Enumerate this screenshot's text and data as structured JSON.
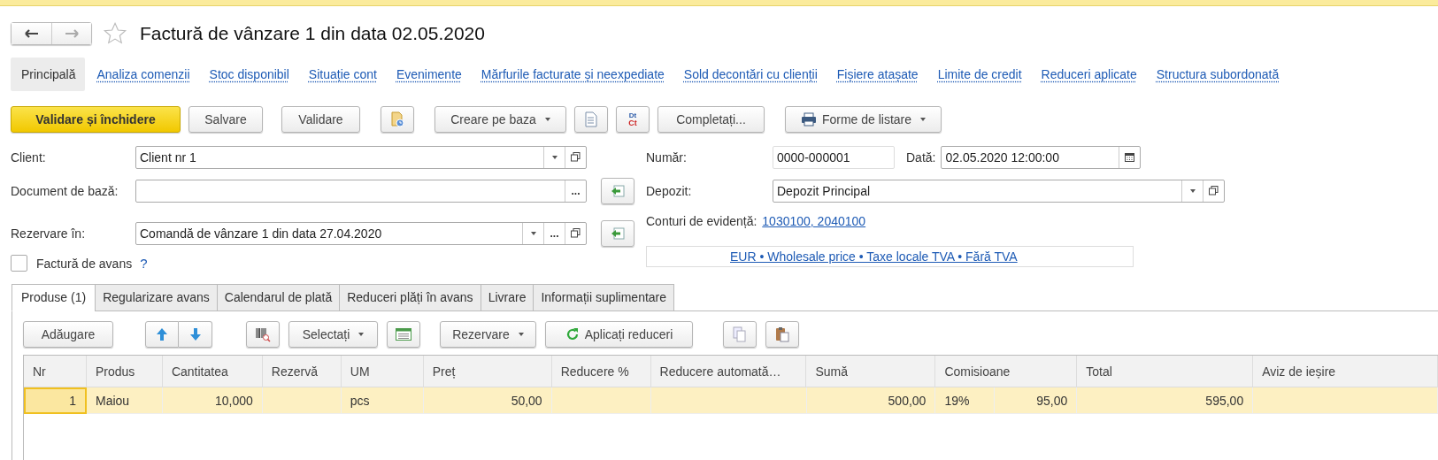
{
  "window": {
    "title": "Factură de vânzare 1 din data 02.05.2020",
    "favorite": false
  },
  "nav": [
    {
      "label": "Principală",
      "selected": true
    },
    {
      "label": "Analiza comenzii",
      "selected": false
    },
    {
      "label": "Stoc disponibil",
      "selected": false
    },
    {
      "label": "Situație cont",
      "selected": false
    },
    {
      "label": "Evenimente",
      "selected": false
    },
    {
      "label": "Mărfurile facturate și neexpediate",
      "selected": false
    },
    {
      "label": "Sold decontări cu clienții",
      "selected": false
    },
    {
      "label": "Fișiere atașate",
      "selected": false
    },
    {
      "label": "Limite de credit",
      "selected": false
    },
    {
      "label": "Reduceri aplicate",
      "selected": false
    },
    {
      "label": "Structura subordonată",
      "selected": false
    }
  ],
  "toolbar": {
    "post_close": "Validare și închidere",
    "save": "Salvare",
    "post": "Validare",
    "create_based": "Creare pe baza",
    "dtct": {
      "top": "Dt",
      "bottom": "Ct"
    },
    "fill": "Completați...",
    "print": "Forme de listare"
  },
  "form": {
    "client": {
      "label": "Client:",
      "value": "Client nr 1"
    },
    "base_document": {
      "label": "Document de bază:",
      "more": "..."
    },
    "reserve_in": {
      "label": "Rezervare în:",
      "value": "Comandă de vânzare 1 din data 27.04.2020",
      "more": "..."
    },
    "advance_invoice": {
      "label": "Factură de avans",
      "checked": false,
      "help": "?"
    },
    "number": {
      "label": "Număr:",
      "value": "0000-000001"
    },
    "date": {
      "label": "Dată:",
      "value": "02.05.2020 12:00:00"
    },
    "warehouse": {
      "label": "Depozit:",
      "value": "Depozit Principal"
    },
    "accounts": {
      "label": "Conturi de evidență:",
      "value": "1030100, 2040100"
    },
    "price_info": "EUR • Wholesale price • Taxe locale TVA • Fără TVA"
  },
  "tabs": [
    {
      "label": "Produse (1)",
      "selected": true
    },
    {
      "label": "Regularizare avans",
      "selected": false
    },
    {
      "label": "Calendarul de plată",
      "selected": false
    },
    {
      "label": "Reduceri plăți în avans",
      "selected": false
    },
    {
      "label": "Livrare",
      "selected": false
    },
    {
      "label": "Informații suplimentare",
      "selected": false
    }
  ],
  "table_toolbar": {
    "add": "Adăugare",
    "select": "Selectați",
    "reserve": "Rezervare",
    "apply_discounts": "Aplicați reduceri"
  },
  "table": {
    "columns": [
      {
        "label": "Nr"
      },
      {
        "label": "Produs"
      },
      {
        "label": "Cantitatea"
      },
      {
        "label": "Rezervă"
      },
      {
        "label": "UM"
      },
      {
        "label": "Preț"
      },
      {
        "label": "Reducere %"
      },
      {
        "label": "Reducere automată…"
      },
      {
        "label": "Sumă"
      },
      {
        "label": "Comisioane"
      },
      {
        "label": "Total"
      },
      {
        "label": "Aviz de ieșire"
      }
    ],
    "rows": [
      {
        "selected": true,
        "cells": [
          "1",
          "Maiou",
          "10,000",
          null,
          "pcs",
          "50,00",
          null,
          null,
          "500,00",
          "19%",
          "95,00",
          "595,00",
          null
        ]
      }
    ]
  }
}
